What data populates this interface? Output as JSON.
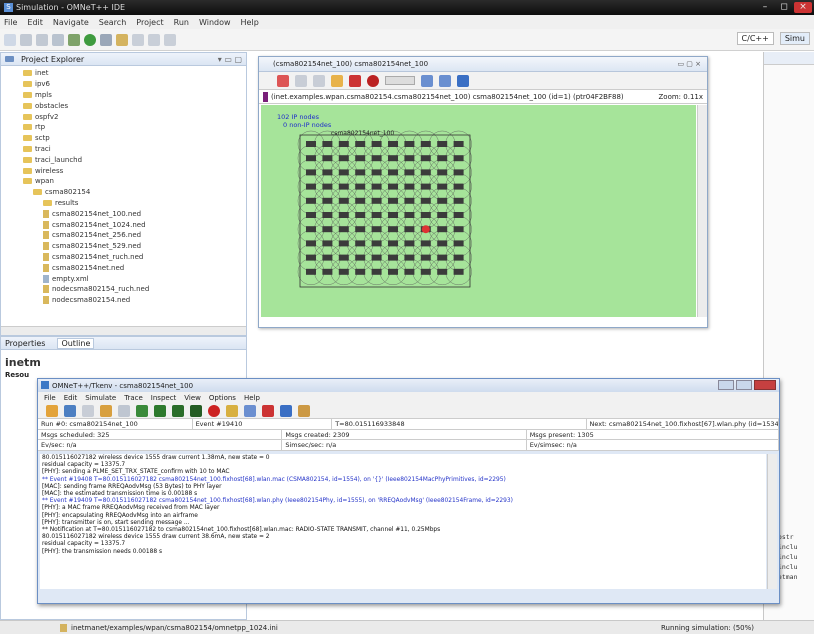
{
  "window": {
    "title": "Simulation - OMNeT++ IDE",
    "controls": [
      "–",
      "◻",
      "×"
    ]
  },
  "menu": [
    "File",
    "Edit",
    "Navigate",
    "Search",
    "Project",
    "Run",
    "Window",
    "Help"
  ],
  "perspectives": [
    "C/C++",
    "Simu"
  ],
  "project_explorer": {
    "title": "Project Explorer",
    "items": [
      {
        "label": "inet",
        "type": "folder",
        "depth": 1
      },
      {
        "label": "ipv6",
        "type": "folder",
        "depth": 1
      },
      {
        "label": "mpls",
        "type": "folder",
        "depth": 1
      },
      {
        "label": "obstacles",
        "type": "folder",
        "depth": 1
      },
      {
        "label": "ospfv2",
        "type": "folder",
        "depth": 1
      },
      {
        "label": "rtp",
        "type": "folder",
        "depth": 1
      },
      {
        "label": "sctp",
        "type": "folder",
        "depth": 1
      },
      {
        "label": "traci",
        "type": "folder",
        "depth": 1
      },
      {
        "label": "traci_launchd",
        "type": "folder",
        "depth": 1
      },
      {
        "label": "wireless",
        "type": "folder",
        "depth": 1
      },
      {
        "label": "wpan",
        "type": "folder",
        "depth": 1
      },
      {
        "label": "csma802154",
        "type": "folder",
        "depth": 2
      },
      {
        "label": "results",
        "type": "folder",
        "depth": 3
      },
      {
        "label": "csma802154net_100.ned",
        "type": "file",
        "depth": 3
      },
      {
        "label": "csma802154net_1024.ned",
        "type": "file",
        "depth": 3
      },
      {
        "label": "csma802154net_256.ned",
        "type": "file",
        "depth": 3
      },
      {
        "label": "csma802154net_529.ned",
        "type": "file",
        "depth": 3
      },
      {
        "label": "csma802154net_ruch.ned",
        "type": "file",
        "depth": 3
      },
      {
        "label": "csma802154net.ned",
        "type": "file",
        "depth": 3
      },
      {
        "label": "empty.xml",
        "type": "xml",
        "depth": 3
      },
      {
        "label": "nodecsma802154_ruch.ned",
        "type": "file",
        "depth": 3
      },
      {
        "label": "nodecsma802154.ned",
        "type": "file",
        "depth": 3
      }
    ]
  },
  "properties_tabs": [
    "Properties",
    "Outline"
  ],
  "properties_heading": "inetm",
  "properties_sub": "Resou",
  "sim_window": {
    "title": "(csma802154net_100) csma802154net_100",
    "path": "(inet.examples.wpan.csma802154.csma802154net_100) csma802154net_100 (id=1) (ptr04F2BF88)",
    "zoom": "Zoom: 0.11x",
    "canvas_labels": [
      "102 IP nodes",
      "0 non-IP nodes"
    ],
    "canvas_title": "csma802154net_100"
  },
  "tkenv": {
    "title": "OMNeT++/Tkenv - csma802154net_100",
    "menu": [
      "File",
      "Edit",
      "Simulate",
      "Trace",
      "Inspect",
      "View",
      "Options",
      "Help"
    ],
    "info": {
      "run": "Run #0: csma802154net_100",
      "event": "Event #19410",
      "time": "T=80.015116933848",
      "next": "Next: csma802154net_100.fixhost[67].wlan.phy (id=1534)",
      "scheduled": "Msgs scheduled: 325",
      "created": "Msgs created: 2309",
      "present": "Msgs present: 1305",
      "evsec": "Ev/sec: n/a",
      "simsec": "Simsec/sec: n/a",
      "evsimsec": "Ev/simsec: n/a"
    },
    "log": [
      {
        "t": "80.015116027182 wireless device 1555 draw current 1.38mA, new state = 0",
        "c": "black"
      },
      {
        "t": "residual capacity = 13375.7",
        "c": "black"
      },
      {
        "t": "[PHY]: sending a PLME_SET_TRX_STATE_confirm with 10 to MAC",
        "c": "black"
      },
      {
        "t": "** Event #19408  T=80.015116027182  csma802154net_100.fixhost[68].wlan.mac (CSMA802154, id=1554), on '{}' (Ieee802154MacPhyPrimitives, id=2295)",
        "c": "blue"
      },
      {
        "t": "[MAC]: sending frame RREQAodvMsg (53 Bytes) to PHY layer",
        "c": "black"
      },
      {
        "t": "[MAC]: the estimated transmission time is 0.00188 s",
        "c": "black"
      },
      {
        "t": "** Event #19409  T=80.015116027182  csma802154net_100.fixhost[68].wlan.phy (Ieee802154Phy, id=1555), on 'RREQAodvMsg' (Ieee802154Frame, id=2293)",
        "c": "blue"
      },
      {
        "t": "[PHY]: a MAC frame RREQAodvMsg received from MAC layer",
        "c": "black"
      },
      {
        "t": "[PHY]: encapsulating RREQAodvMsg into an airframe",
        "c": "black"
      },
      {
        "t": "[PHY]: transmitter is on, start sending message ...",
        "c": "black"
      },
      {
        "t": "** Notification at T=80.015116027182 to csma802154net_100.fixhost[68].wlan.mac: RADIO-STATE TRANSMIT, channel #11, 0.25Mbps",
        "c": "black"
      },
      {
        "t": "80.015116027182 wireless device 1555 draw current 38.6mA, new state = 2",
        "c": "black"
      },
      {
        "t": "residual capacity = 13375.7",
        "c": "black"
      },
      {
        "t": "[PHY]: the transmission needs 0.00188 s",
        "c": "black"
      }
    ]
  },
  "right_pane": [
    "abstr",
    "#inclu",
    "#inclu",
    "#inclu",
    "netman"
  ],
  "status": {
    "path": "inetmanet/examples/wpan/csma802154/omnetpp_1024.ini",
    "running": "Running simulation: (50%)"
  },
  "colors": {
    "canvas_green": "#a6e49a",
    "log_blue": "#2433c8",
    "title_dark": "#1a1a1a"
  }
}
